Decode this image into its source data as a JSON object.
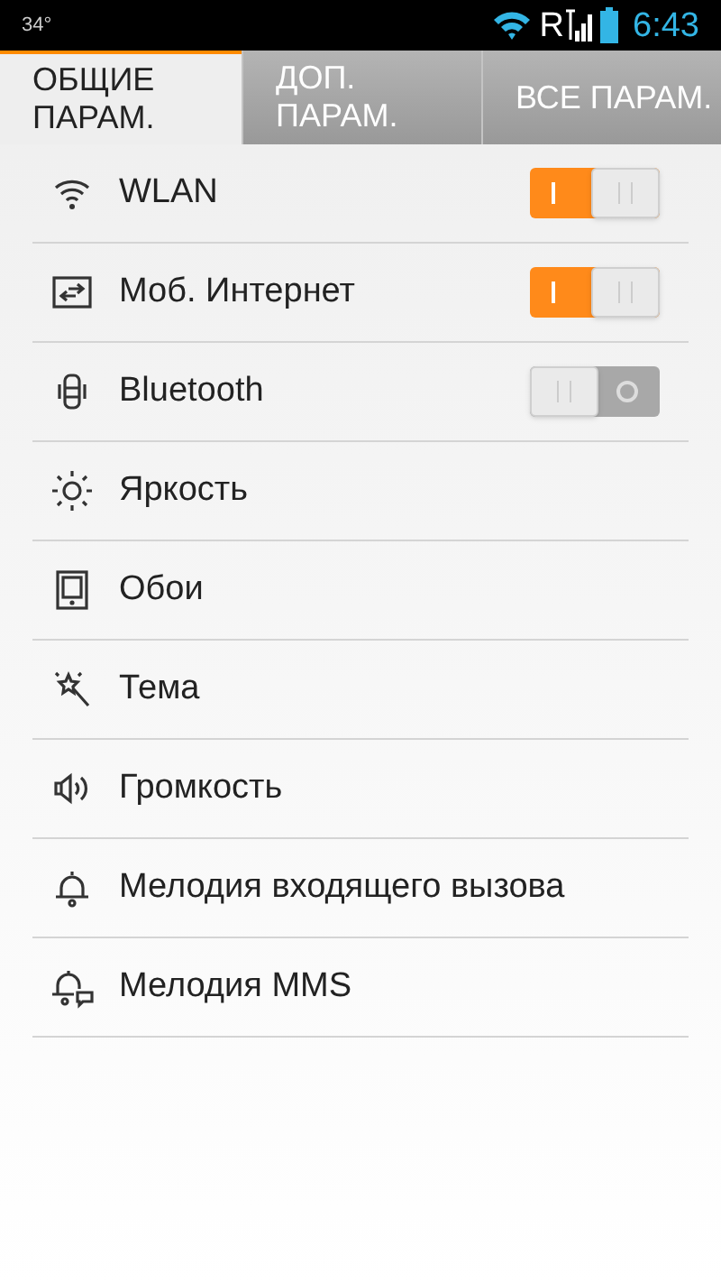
{
  "status_bar": {
    "temperature": "34°",
    "network": "R",
    "time": "6:43"
  },
  "tabs": [
    {
      "label": "ОБЩИЕ ПАРАМ.",
      "selected": true
    },
    {
      "label": "ДОП. ПАРАМ.",
      "selected": false
    },
    {
      "label": "ВСЕ ПАРАМ.",
      "selected": false
    }
  ],
  "settings": [
    {
      "kind": "toggle",
      "label": "WLAN",
      "on": true
    },
    {
      "kind": "toggle",
      "label": "Моб. Интернет",
      "on": true
    },
    {
      "kind": "toggle",
      "label": "Bluetooth",
      "on": false
    },
    {
      "kind": "link",
      "label": "Яркость"
    },
    {
      "kind": "link",
      "label": "Обои"
    },
    {
      "kind": "link",
      "label": "Тема"
    },
    {
      "kind": "link",
      "label": "Громкость"
    },
    {
      "kind": "link",
      "label": "Мелодия входящего вызова"
    },
    {
      "kind": "link",
      "label": "Мелодия MMS"
    }
  ]
}
